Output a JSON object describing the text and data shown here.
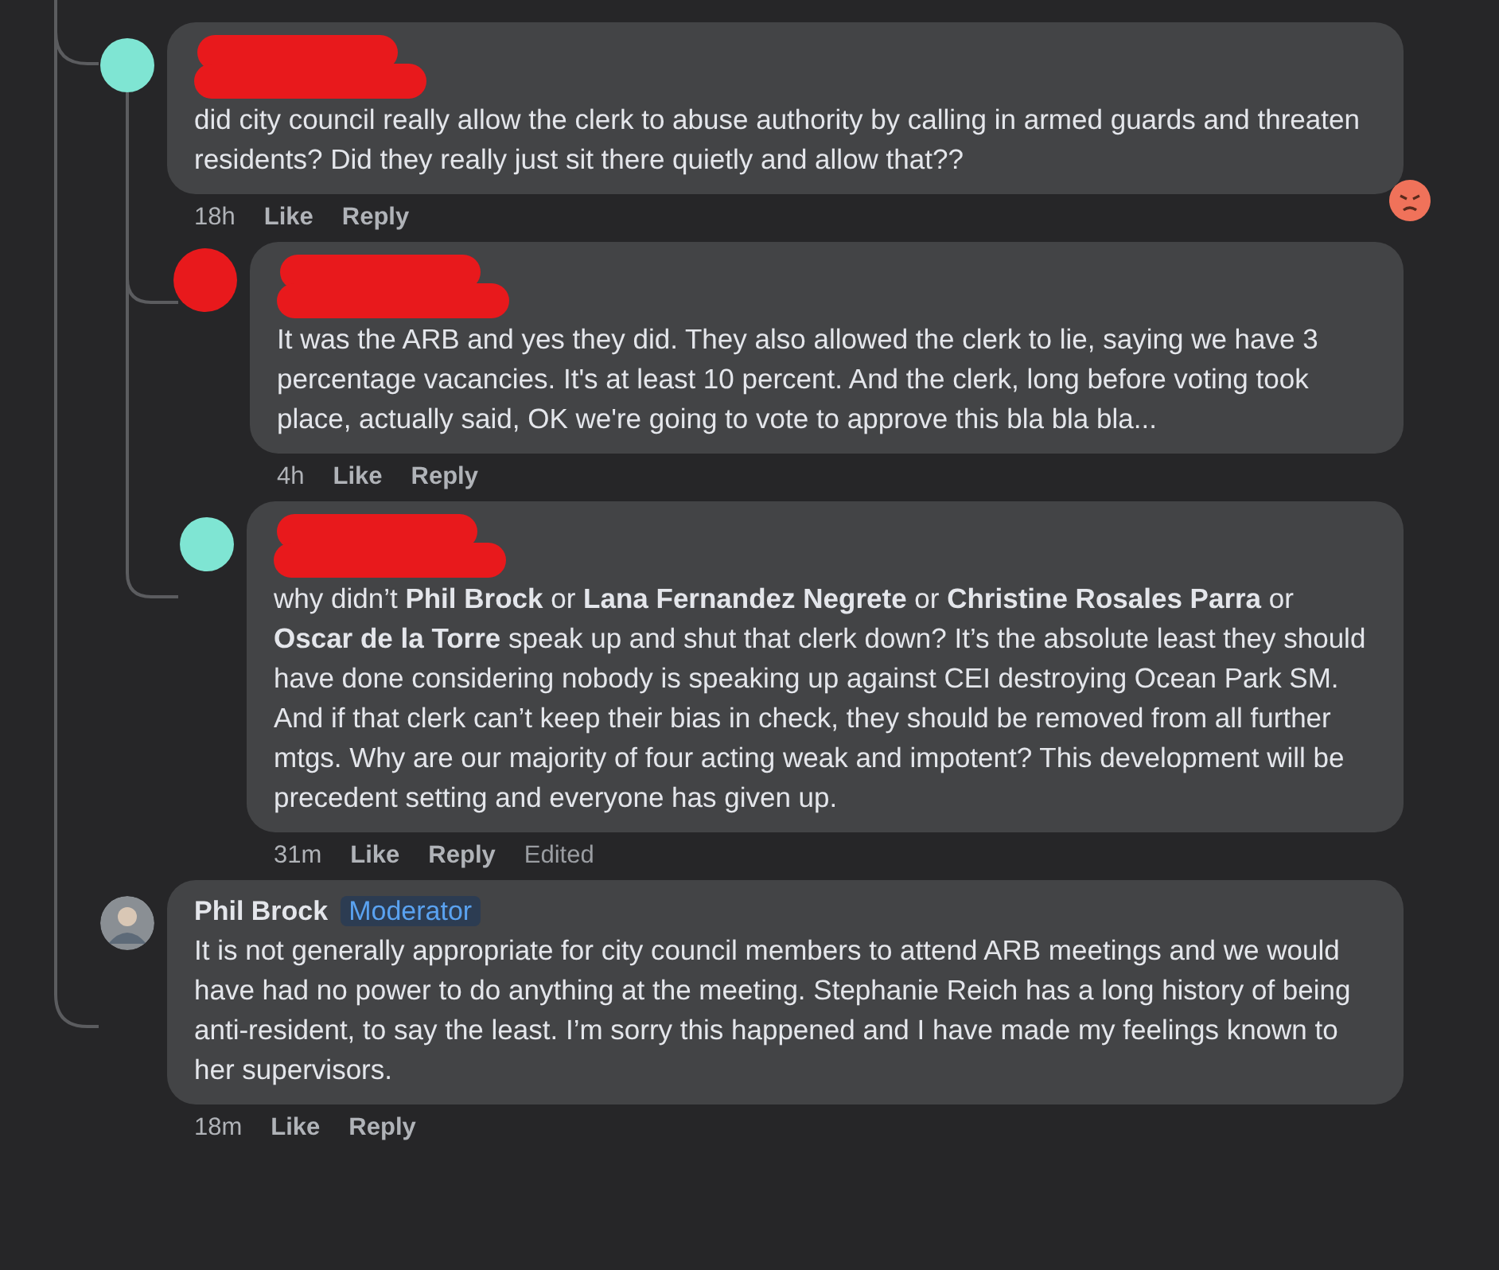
{
  "comments": [
    {
      "author_redacted": true,
      "body_redacted": true,
      "avatar": {
        "kind": "circle",
        "color": "#7fe5d3"
      },
      "body": "did city council really allow the clerk to abuse authority by calling in armed guards and threaten residents? Did they really just sit there quietly and allow that??",
      "reaction": {
        "kind": "angry"
      },
      "meta": [
        {
          "kind": "time",
          "text": "18h"
        },
        {
          "kind": "action",
          "text": "Like"
        },
        {
          "kind": "action",
          "text": "Reply"
        }
      ],
      "replies": [
        {
          "author_redacted": true,
          "body_redacted": true,
          "avatar": {
            "kind": "redacted"
          },
          "body": "It was the ARB and yes they did. They also allowed the clerk to lie, saying we have 3 percentage vacancies. It's at least 10 percent. And the clerk, long before voting took place, actually said, OK we're going to vote to approve this bla bla bla...",
          "meta": [
            {
              "kind": "time",
              "text": "4h"
            },
            {
              "kind": "action",
              "text": "Like"
            },
            {
              "kind": "action",
              "text": "Reply"
            }
          ]
        },
        {
          "author_redacted": true,
          "body_redacted": true,
          "avatar": {
            "kind": "circle",
            "color": "#7fe5d3"
          },
          "body": "why didn’t **Phil Brock** or **Lana Fernandez Negrete** or **Christine Rosales Parra** or **Oscar de la Torre** speak up and shut that clerk down? It’s the absolute least they should have done considering nobody is speaking up against CEI destroying Ocean Park SM. And if that clerk can’t keep their bias in check, they should be removed from all further mtgs. Why are our majority of four acting weak and impotent? This development will be precedent setting and everyone has given up.",
          "meta": [
            {
              "kind": "time",
              "text": "31m"
            },
            {
              "kind": "action",
              "text": "Like"
            },
            {
              "kind": "action",
              "text": "Reply"
            },
            {
              "kind": "note",
              "text": "Edited"
            }
          ]
        }
      ]
    },
    {
      "author": "Phil Brock",
      "badge": "Moderator",
      "avatar": {
        "kind": "photo"
      },
      "body": "It is not generally appropriate for city council members to attend ARB meetings and we would have had no power to do anything at the meeting. Stephanie Reich has a long history of being anti-resident, to say the least. I’m sorry this happened and I have made my feelings known to her supervisors.",
      "meta": [
        {
          "kind": "time",
          "text": "18m"
        },
        {
          "kind": "action",
          "text": "Like"
        },
        {
          "kind": "action",
          "text": "Reply"
        }
      ]
    }
  ]
}
